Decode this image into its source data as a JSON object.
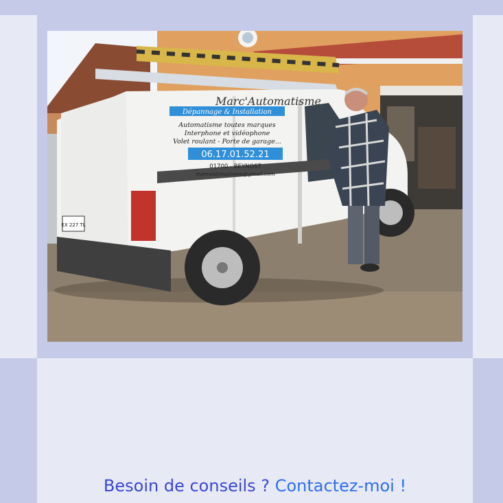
{
  "photo": {
    "van_brand": "Marc'Automatisme",
    "van_tagline": "Dépannage & Installation",
    "van_line1": "Automatisme toutes marques",
    "van_line2": "Interphone et vidéophone",
    "van_line3": "Volet roulant - Porte de garage...",
    "van_phone": "06.17.01.52.21",
    "van_city": "01700 - BEYNOST",
    "van_email": "marcautomatisme@gmail.com",
    "plate": "EX 227 TL"
  },
  "contact": {
    "question": "Besoin de conseils ?",
    "link_label": "Contactez-moi !"
  },
  "colors": {
    "frame": "#c6cae9",
    "background": "#e7eaf5",
    "question": "#3b46d6",
    "link": "#2d6ff0"
  }
}
